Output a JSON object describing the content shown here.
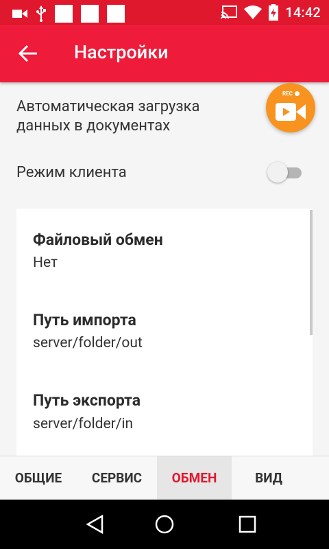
{
  "status_bar": {
    "time": "14:42"
  },
  "app_bar": {
    "title": "Настройки",
    "back_icon": "arrow-back-icon"
  },
  "settings": {
    "auto_load_line1": "Автоматическая загрузка",
    "auto_load_line2": "данных в документах",
    "client_mode": "Режим клиента",
    "client_mode_enabled": false
  },
  "fab": {
    "label": "REC",
    "icon": "video-camera-icon",
    "color": "#f7931e"
  },
  "card": {
    "items": [
      {
        "title": "Файловый обмен",
        "value": "Нет"
      },
      {
        "title": "Путь импорта",
        "value": "server/folder/out"
      },
      {
        "title": "Путь экспорта",
        "value": "server/folder/in"
      }
    ]
  },
  "tabs": [
    {
      "label": "ОБЩИЕ",
      "active": false
    },
    {
      "label": "СЕРВИС",
      "active": false
    },
    {
      "label": "ОБМЕН",
      "active": true
    },
    {
      "label": "ВИД",
      "active": false
    }
  ],
  "colors": {
    "primary": "#ee1c3a",
    "status": "#e0182d",
    "accent": "#f7931e"
  }
}
